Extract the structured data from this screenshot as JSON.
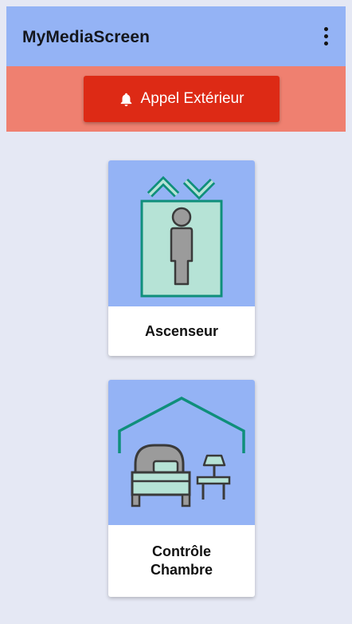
{
  "app": {
    "title": "MyMediaScreen",
    "menu_icon": "more-vert-icon"
  },
  "alert": {
    "label": "Appel Extérieur",
    "icon": "bell-icon",
    "button_color": "#dd2a15",
    "band_color": "#ef8070"
  },
  "tiles": [
    {
      "label": "Ascenseur",
      "icon": "elevator-icon"
    },
    {
      "label": "Contrôle\nChambre",
      "icon": "bedroom-icon"
    }
  ],
  "colors": {
    "appbar": "#94b3f5",
    "background": "#e5e8f4",
    "accent_teal": "#0f8f7b"
  }
}
